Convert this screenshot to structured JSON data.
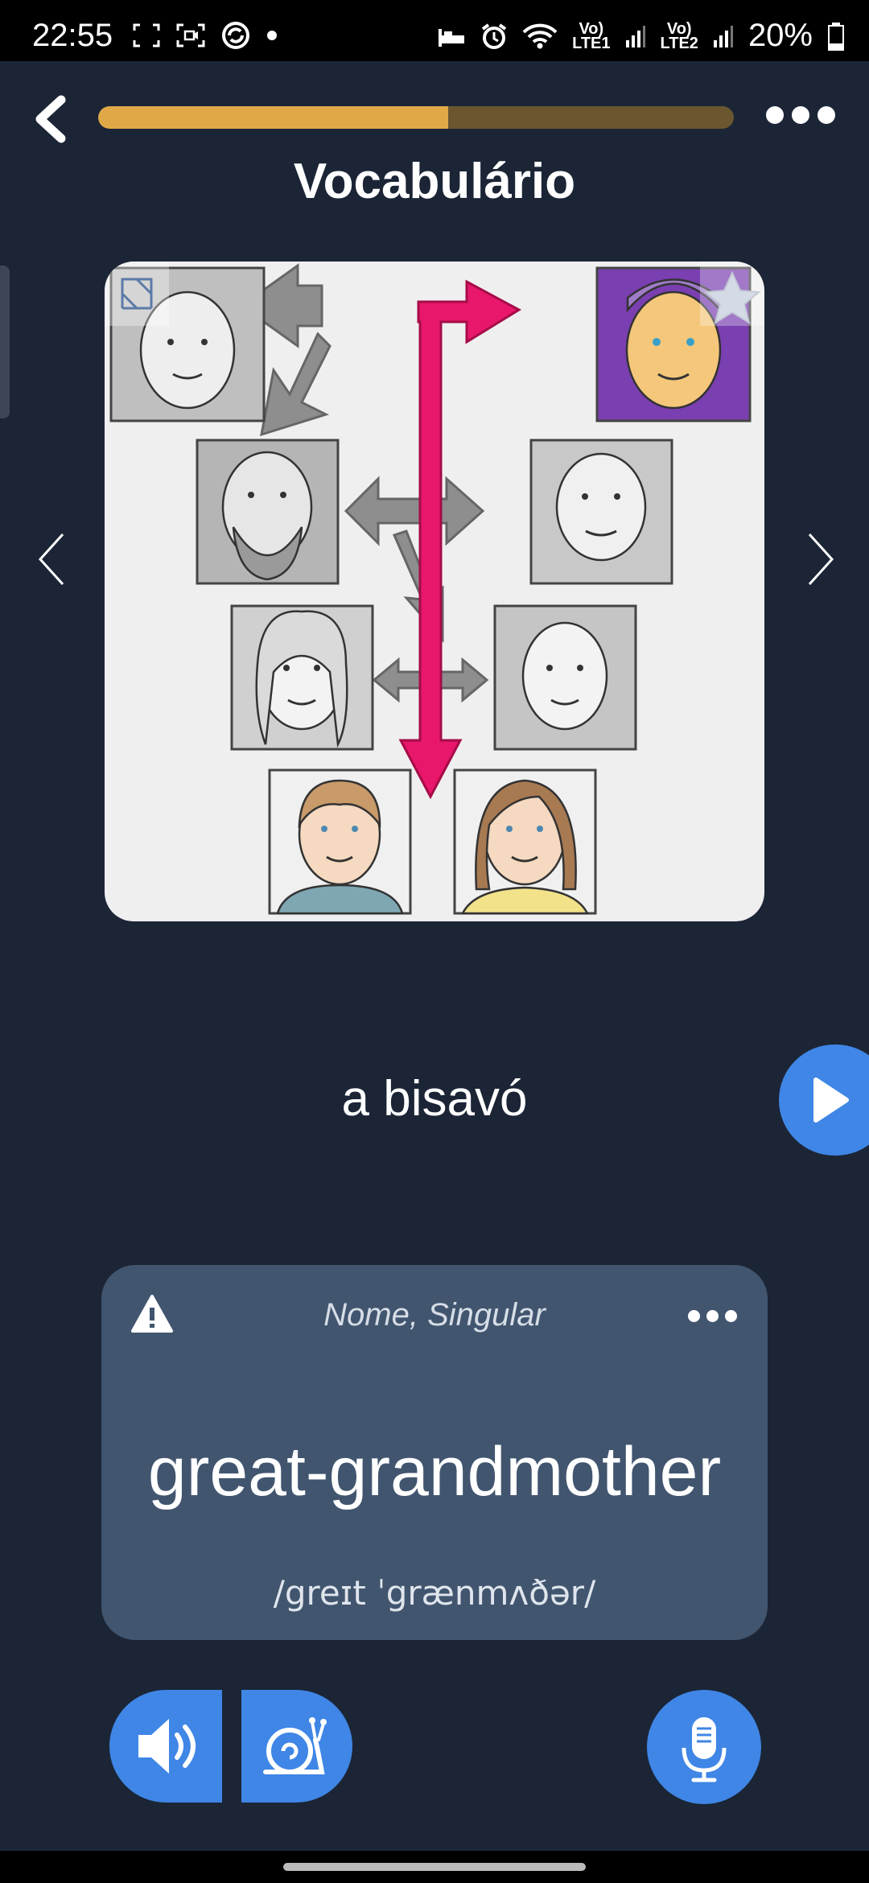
{
  "status_bar": {
    "time": "22:55",
    "sim1_label": "Vo)",
    "sim1_sub": "LTE1",
    "sim2_label": "Vo)",
    "sim2_sub": "LTE2",
    "battery": "20%"
  },
  "header": {
    "title": "Vocabulário",
    "progress_fraction": 0.55
  },
  "lesson": {
    "word": "a bisavó"
  },
  "translation": {
    "meta": "Nome, Singular",
    "word": "great-grandmother",
    "ipa": "/greɪt ˈgrænmʌðər/"
  },
  "colors": {
    "background": "#1b2536",
    "progress_fill": "#e0a847",
    "progress_track": "#6b5630",
    "accent_blue": "#3f86e6",
    "card": "#41556f",
    "arrow_pink": "#e8176b"
  },
  "icons": {
    "back": "chevron-left-icon",
    "more": "more-horizontal-icon",
    "expand": "expand-icon",
    "favorite": "star-icon",
    "prev": "chevron-left-icon",
    "next": "chevron-right-icon",
    "play": "play-icon",
    "warning": "warning-icon",
    "speaker": "speaker-icon",
    "slow": "snail-icon",
    "microphone": "microphone-icon"
  }
}
